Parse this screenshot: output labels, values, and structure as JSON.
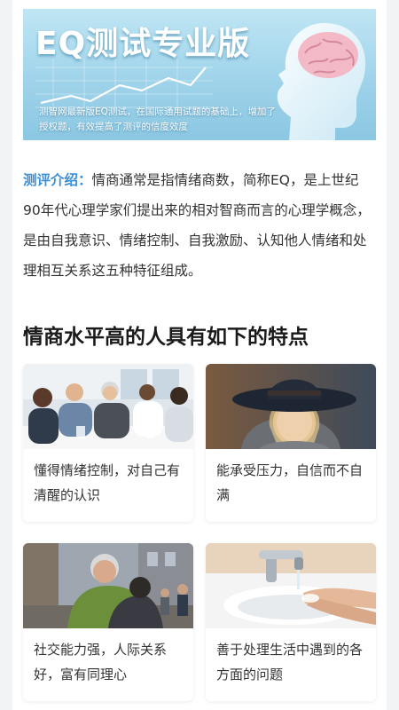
{
  "banner": {
    "title": "EQ测试专业版",
    "description": "测智网最新版EQ测试，在国际通用试题的基础上，增加了授权题，有效提高了测评的信度效度"
  },
  "intro": {
    "label": "测评介绍：",
    "text": "情商通常是指情绪商数，简称EQ，是上世纪90年代心理学家们提出来的相对智商而言的心理学概念，是由自我意识、情绪控制、自我激励、认知他人情绪和处理相互关系这五种特征组成。"
  },
  "section": {
    "title": "情商水平高的人具有如下的特点"
  },
  "cards": [
    {
      "text": "懂得情绪控制，对自己有清醒的认识",
      "image": "meeting-people-photo"
    },
    {
      "text": "能承受压力，自信而不自满",
      "image": "girl-hat-photo"
    },
    {
      "text": "社交能力强，人际关系好，富有同理心",
      "image": "hug-street-photo"
    },
    {
      "text": "善于处理生活中遇到的各方面的问题",
      "image": "washing-hands-photo"
    }
  ],
  "colors": {
    "accent": "#3b8fd6",
    "banner_bg": "#9fd3ea",
    "text": "#333333"
  }
}
